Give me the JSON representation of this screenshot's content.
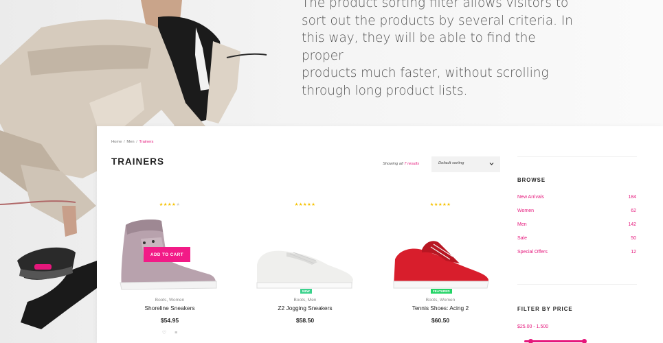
{
  "promo": {
    "lines": [
      "The product sorting filter allows visitors to",
      "sort out the products by several criteria. In",
      "this way, they will be able to find the proper",
      "products much faster, without scrolling",
      "through long product lists."
    ]
  },
  "breadcrumb": {
    "home": "Home",
    "men": "Men",
    "current": "Trainers",
    "separator": "/"
  },
  "page_title": "TRAINERS",
  "results": {
    "prefix": "Showing all",
    "count_text": "7 results"
  },
  "sort": {
    "selected": "Default sorting"
  },
  "products": [
    {
      "stars_on": "★★★★",
      "stars_off": "★",
      "categories": "Boots, Women",
      "name": "Shoreline Sneakers",
      "price": "$54.95",
      "cta": "ADD TO CART",
      "icons": [
        "heart-icon",
        "compare-icon"
      ],
      "color": "#b9a3ad"
    },
    {
      "stars_on": "★★★★★",
      "stars_off": "",
      "badge": "NEW",
      "categories": "Boots, Men",
      "name": "Z2 Jogging Sneakers",
      "price": "$58.50",
      "color": "#f0f0ee"
    },
    {
      "stars_on": "★★★★★",
      "stars_off": "",
      "badge": "FEATURED",
      "categories": "Boots, Women",
      "name": "Tennis Shoes: Acing 2",
      "price": "$60.50",
      "color": "#d81e2c"
    }
  ],
  "sidebar": {
    "browse_title": "BROWSE",
    "browse": [
      {
        "label": "New Arrivals",
        "count": "184"
      },
      {
        "label": "Women",
        "count": "62"
      },
      {
        "label": "Men",
        "count": "142"
      },
      {
        "label": "Sale",
        "count": "50"
      },
      {
        "label": "Special Offers",
        "count": "12"
      }
    ],
    "filter_title": "FILTER BY PRICE",
    "price_range": "$25.00 - 1.500"
  },
  "colors": {
    "accent": "#e5177b",
    "cta": "#f21b87",
    "star": "#f6c200"
  }
}
